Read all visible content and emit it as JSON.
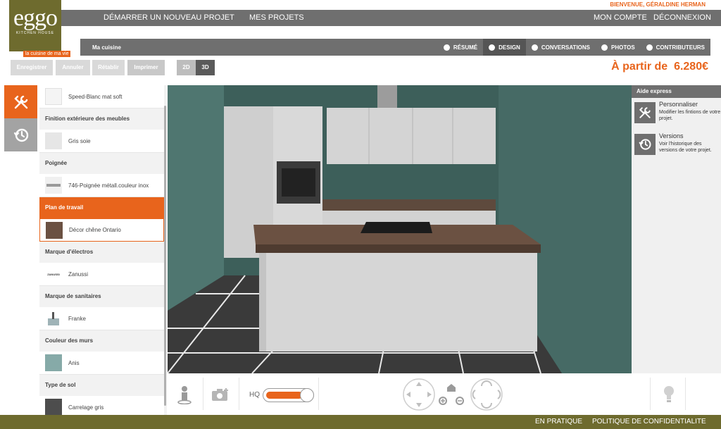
{
  "logo": {
    "brand": "eggo",
    "sub": "KITCHEN HOUSE",
    "tagline": "la cuisine de ma vie"
  },
  "welcome": "BIENVENUE, GÉRALDINE HERMAN",
  "topnav": {
    "new_project": "DÉMARRER UN NOUVEAU PROJET",
    "my_projects": "MES PROJETS",
    "my_account": "MON COMPTE",
    "logout": "DÉCONNEXION"
  },
  "project": {
    "name": "Ma cuisine"
  },
  "tabs": [
    {
      "label": "RÉSUMÉ",
      "icon": "eye-icon"
    },
    {
      "label": "DESIGN",
      "icon": "pencil-icon"
    },
    {
      "label": "CONVERSATIONS",
      "icon": "chat-icon"
    },
    {
      "label": "PHOTOS",
      "icon": "camera-icon"
    },
    {
      "label": "CONTRIBUTEURS",
      "icon": "person-icon"
    }
  ],
  "toolbar": {
    "save": "Enregistrer",
    "cancel": "Annuler",
    "redo": "Rétablir",
    "print": "Imprimer",
    "view_2d": "2D",
    "view_3d": "3D"
  },
  "price": {
    "prefix": "À partir de",
    "value": "6.280€"
  },
  "options": {
    "first_item": "Speed-Blanc mat soft",
    "sections": [
      {
        "title": "Finition extérieure des meubles",
        "value": "Gris soie",
        "swatch": "#e6e6e6"
      },
      {
        "title": "Poignée",
        "value": "746-Poignée métall.couleur inox",
        "swatch": "#cfcfcf"
      },
      {
        "title": "Plan de travail",
        "value": "Décor chêne Ontario",
        "swatch": "#6b5142"
      },
      {
        "title": "Marque d'électros",
        "value": "Zanussi",
        "logo_text": "ZANUSSI"
      },
      {
        "title": "Marque de sanitaires",
        "value": "Franke",
        "swatch": "#9fb3b7"
      },
      {
        "title": "Couleur des murs",
        "value": "Anis",
        "swatch": "#86aaa8"
      },
      {
        "title": "Type de sol",
        "value": "Carrelage gris",
        "swatch": "#4d4d4d"
      }
    ]
  },
  "help": {
    "title": "Aide express",
    "items": [
      {
        "title": "Personnaliser",
        "desc": "Modifier les fintions de votre projet.",
        "icon": "tools-icon"
      },
      {
        "title": "Versions",
        "desc": "Voir l'historique des versions de votre projet.",
        "icon": "history-icon"
      }
    ]
  },
  "controls": {
    "hq_label": "HQ",
    "hq_on": true
  },
  "footer": {
    "practical": "EN PRATIQUE",
    "privacy": "POLITIQUE DE CONFIDENTIALITE"
  },
  "colors": {
    "accent": "#e8641c",
    "olive": "#6e6b2e",
    "nav_gray": "#6f6f6f"
  }
}
